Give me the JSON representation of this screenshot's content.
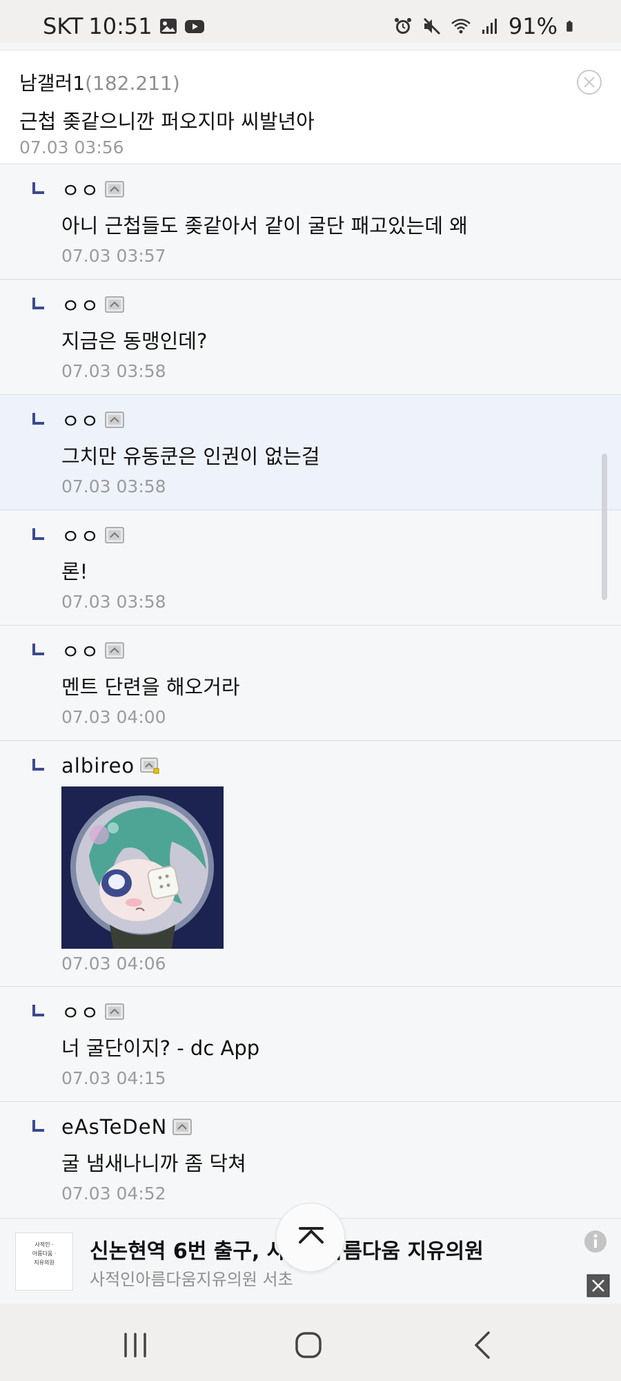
{
  "status_bar": {
    "carrier": "SKT",
    "time": "10:51",
    "battery_percent": "91%",
    "icons": [
      "gallery-icon",
      "youtube-icon",
      "alarm-icon",
      "mute-icon",
      "wifi-icon",
      "signal-icon",
      "battery-icon"
    ]
  },
  "parent_comment": {
    "author": "남갤러1",
    "ip": "(182.211)",
    "body": "근첩 좆같으니깐 퍼오지마 씨발년아",
    "date": "07.03 03:56"
  },
  "replies": [
    {
      "author": "ㅇㅇ",
      "body": "아니 근첩들도 좆같아서 같이 굴단 패고있는데 왜",
      "date": "07.03 03:57",
      "highlighted": false,
      "has_image": false
    },
    {
      "author": "ㅇㅇ",
      "body": "지금은 동맹인데?",
      "date": "07.03 03:58",
      "highlighted": false,
      "has_image": false
    },
    {
      "author": "ㅇㅇ",
      "body": "그치만 유동쿤은 인권이 없는걸",
      "date": "07.03 03:58",
      "highlighted": true,
      "has_image": false
    },
    {
      "author": "ㅇㅇ",
      "body": "론!",
      "date": "07.03 03:58",
      "highlighted": false,
      "has_image": false
    },
    {
      "author": "ㅇㅇ",
      "body": "멘트 단련을 해오거라",
      "date": "07.03 04:00",
      "highlighted": false,
      "has_image": false
    },
    {
      "author": "albireo",
      "body": "",
      "date": "07.03 04:06",
      "highlighted": false,
      "has_image": true
    },
    {
      "author": "ㅇㅇ",
      "body": "너 굴단이지? - dc App",
      "date": "07.03 04:15",
      "highlighted": false,
      "has_image": false
    },
    {
      "author": "eAsTeDeN",
      "body": "굴 냄새나니까 좀 닥쳐",
      "date": "07.03 04:52",
      "highlighted": false,
      "has_image": false
    }
  ],
  "ad": {
    "logo_lines": [
      "사적인 ·",
      "아름다움 ·",
      "지유의원"
    ],
    "title": "신논현역 6번 출구, 사적인아름다움 지유의원",
    "subtitle": "사적인아름다움지유의원 서초"
  },
  "colors": {
    "accent_arrow": "#3b4a8f",
    "highlight_row": "#eef2fb",
    "date_gray": "#9b9b9b"
  }
}
